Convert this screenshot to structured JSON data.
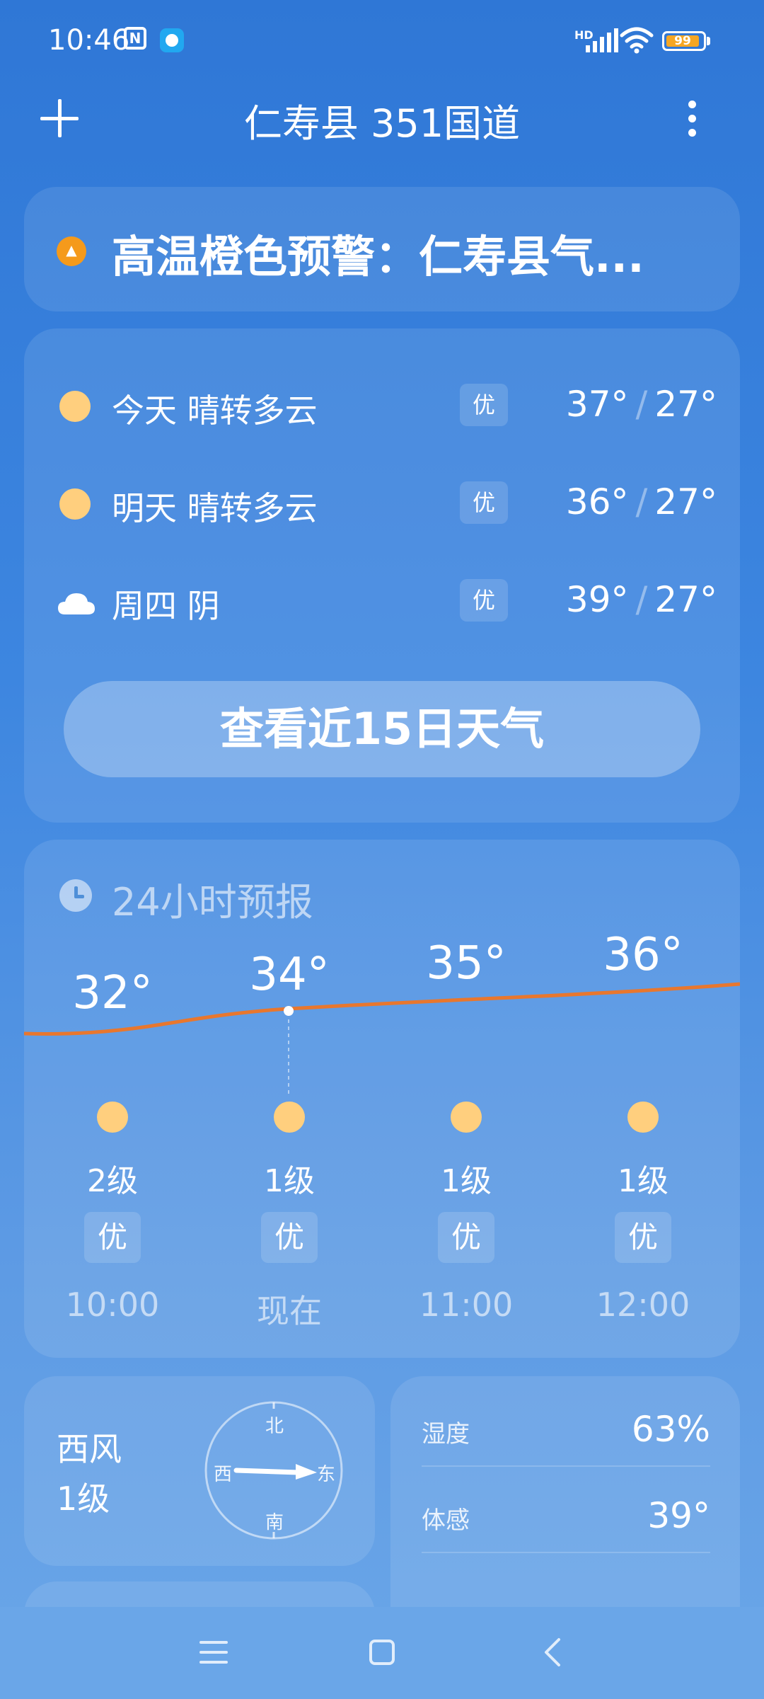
{
  "status_bar": {
    "time": "10:46",
    "nfc_label": "N",
    "network_label": "HD",
    "battery_level": "99",
    "battery_color": "#f5a623"
  },
  "header": {
    "title": "仁寿县 351国道",
    "add_icon": "plus-icon",
    "more_icon": "more-vertical-icon"
  },
  "alert": {
    "text": "高温橙色预警：仁寿县气...",
    "icon": "alert-up-arrow-icon",
    "icon_color": "#f59a1b"
  },
  "daily": {
    "days": [
      {
        "label": "今天  晴转多云",
        "icon": "sun-icon",
        "aqi": "优",
        "high": "37°",
        "low": "27°"
      },
      {
        "label": "明天  晴转多云",
        "icon": "sun-icon",
        "aqi": "优",
        "high": "36°",
        "low": "27°"
      },
      {
        "label": "周四  阴",
        "icon": "cloud-icon",
        "aqi": "优",
        "high": "39°",
        "low": "27°"
      }
    ],
    "separator": "/",
    "button_label": "查看近15日天气"
  },
  "hourly": {
    "title": "24小时预报",
    "icon": "clock-icon",
    "line_color": "#e8772e",
    "hours": [
      {
        "temp": "32°",
        "icon": "sun-icon",
        "wind": "2级",
        "aqi": "优",
        "time": "10:00"
      },
      {
        "temp": "34°",
        "icon": "sun-icon",
        "wind": "1级",
        "aqi": "优",
        "time": "现在"
      },
      {
        "temp": "35°",
        "icon": "sun-icon",
        "wind": "1级",
        "aqi": "优",
        "time": "11:00"
      },
      {
        "temp": "36°",
        "icon": "sun-icon",
        "wind": "1级",
        "aqi": "优",
        "time": "12:00"
      }
    ]
  },
  "wind": {
    "direction": "西风",
    "level": "1级",
    "compass": {
      "north": "北",
      "south": "南",
      "west": "西",
      "east": "东"
    }
  },
  "details": {
    "rows": [
      {
        "label": "湿度",
        "value": "63%"
      },
      {
        "label": "体感",
        "value": "39°"
      }
    ]
  },
  "nav": {
    "menu_icon": "menu-icon",
    "home_icon": "home-icon",
    "back_icon": "back-icon"
  }
}
